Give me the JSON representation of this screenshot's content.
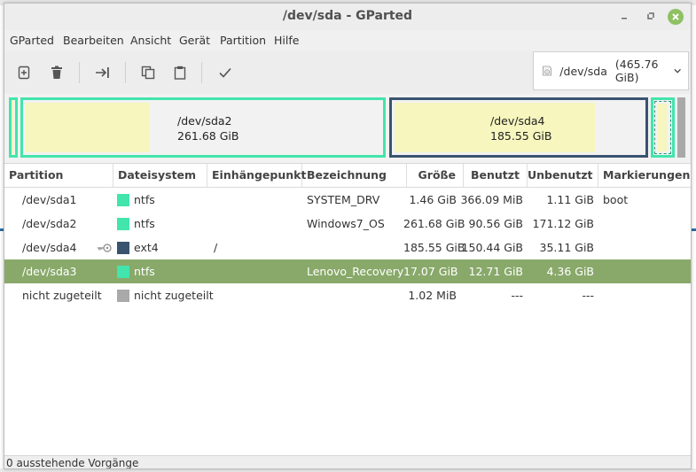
{
  "window": {
    "title": "/dev/sda - GParted"
  },
  "menu": [
    "GParted",
    "Bearbeiten",
    "Ansicht",
    "Gerät",
    "Partition",
    "Hilfe"
  ],
  "toolbar": {
    "icons": [
      "new-partition-icon",
      "delete-icon",
      "resize-move-icon",
      "copy-icon",
      "paste-icon",
      "apply-icon"
    ]
  },
  "device": {
    "name": "/dev/sda",
    "size": "(465.76 GiB)"
  },
  "map": {
    "sda2_name": "/dev/sda2",
    "sda2_size": "261.68 GiB",
    "sda4_name": "/dev/sda4",
    "sda4_size": "185.55 GiB"
  },
  "table": {
    "headers": [
      "Partition",
      "Dateisystem",
      "Einhängepunkt",
      "Bezeichnung",
      "Größe",
      "Benutzt",
      "Unbenutzt",
      "Markierungen"
    ],
    "rows": [
      {
        "partition": "/dev/sda1",
        "fs": "ntfs",
        "mount": "",
        "label": "SYSTEM_DRV",
        "size": "1.46 GiB",
        "used": "366.09 MiB",
        "unused": "1.11 GiB",
        "flags": "boot"
      },
      {
        "partition": "/dev/sda2",
        "fs": "ntfs",
        "mount": "",
        "label": "Windows7_OS",
        "size": "261.68 GiB",
        "used": "90.56 GiB",
        "unused": "171.12 GiB",
        "flags": ""
      },
      {
        "partition": "/dev/sda4",
        "fs": "ext4",
        "mount": "/",
        "label": "",
        "size": "185.55 GiB",
        "used": "150.44 GiB",
        "unused": "35.11 GiB",
        "flags": ""
      },
      {
        "partition": "/dev/sda3",
        "fs": "ntfs",
        "mount": "",
        "label": "Lenovo_Recovery",
        "size": "17.07 GiB",
        "used": "12.71 GiB",
        "unused": "4.36 GiB",
        "flags": ""
      },
      {
        "partition": "nicht zugeteilt",
        "fs": "nicht zugeteilt",
        "mount": "",
        "label": "",
        "size": "1.02 MiB",
        "used": "---",
        "unused": "---",
        "flags": ""
      }
    ]
  },
  "colors": {
    "ntfs": "#42e5ac",
    "ext4": "#3a5370",
    "unallocated": "#a9a9a9",
    "selected_row": "#89a96a",
    "used_fill": "#f6f6be"
  },
  "status": {
    "text": "0 ausstehende Vorgänge"
  }
}
